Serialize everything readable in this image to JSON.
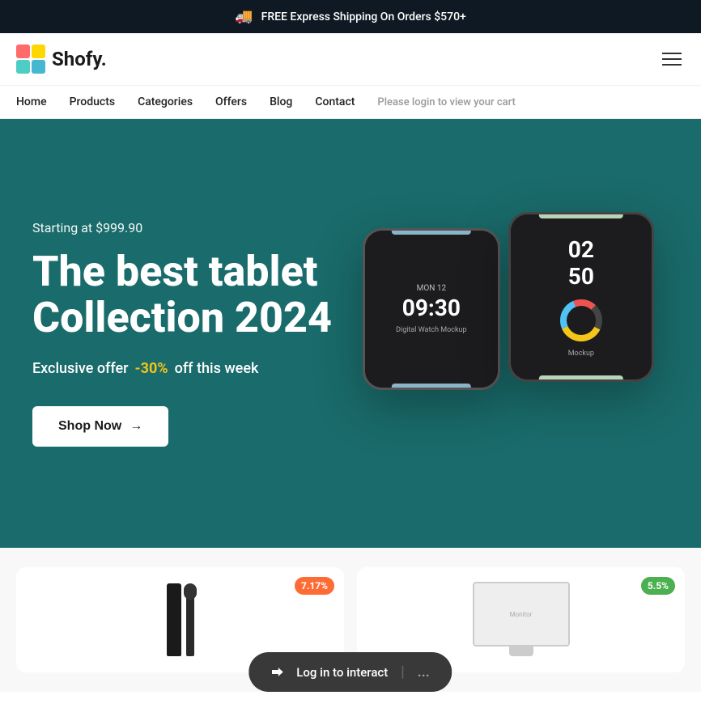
{
  "banner": {
    "icon": "🚚",
    "text": "FREE Express Shipping On Orders $570+"
  },
  "header": {
    "logo_text": "Shofy.",
    "hamburger_label": "Menu"
  },
  "nav": {
    "items": [
      {
        "label": "Home",
        "href": "#"
      },
      {
        "label": "Products",
        "href": "#"
      },
      {
        "label": "Categories",
        "href": "#"
      },
      {
        "label": "Offers",
        "href": "#"
      },
      {
        "label": "Blog",
        "href": "#"
      },
      {
        "label": "Contact",
        "href": "#"
      },
      {
        "label": "Please login to view your cart",
        "href": "#"
      }
    ]
  },
  "hero": {
    "subtitle": "Starting at $999.90",
    "title_line1": "The best tablet",
    "title_line2": "Collection 2024",
    "offer_prefix": "Exclusive offer",
    "offer_discount": "-30%",
    "offer_suffix": "off this week",
    "cta_label": "Shop Now",
    "cta_arrow": "→"
  },
  "watches": {
    "left": {
      "date": "MON 12",
      "time": "09:30",
      "label": "Digital Watch Mockup"
    },
    "right": {
      "time1": "02",
      "time2": "50",
      "label": "Mockup"
    }
  },
  "products": {
    "card1": {
      "badge": "7.17%"
    },
    "card2": {
      "badge": "5.5%"
    }
  },
  "login_overlay": {
    "icon": "→",
    "text": "Log in to interact",
    "more": "..."
  }
}
